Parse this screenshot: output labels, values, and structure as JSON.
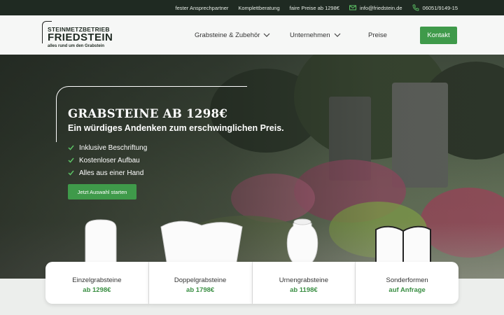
{
  "topbar": {
    "items": [
      "fester Ansprechpartner",
      "Komplettberatung",
      "faire Preise ab 1298€"
    ],
    "email": "info@friedstein.de",
    "phone": "06051/9149-15"
  },
  "logo": {
    "line1": "STEINMETZBETRIEB",
    "line2": "FRIEDSTEIN",
    "line3": "alles rund um den Grabstein"
  },
  "nav": {
    "items": [
      {
        "label": "Grabsteine & Zubehör",
        "dropdown": true
      },
      {
        "label": "Unternehmen",
        "dropdown": true
      },
      {
        "label": "Preise",
        "dropdown": false
      }
    ],
    "contact_button": "Kontakt"
  },
  "hero": {
    "title": "GRABSTEINE AB 1298€",
    "subtitle": "Ein würdiges Andenken zum erschwinglichen Preis.",
    "features": [
      "Inklusive Beschriftung",
      "Kostenloser Aufbau",
      "Alles aus einer Hand"
    ],
    "cta": "Jetzt Auswahl starten"
  },
  "categories": [
    {
      "name": "Einzelgrabsteine",
      "price": "ab 1298€",
      "icon": "single-stone-icon"
    },
    {
      "name": "Doppelgrabsteine",
      "price": "ab 1798€",
      "icon": "double-stone-icon"
    },
    {
      "name": "Urnengrabsteine",
      "price": "ab 1198€",
      "icon": "urn-stone-icon"
    },
    {
      "name": "Sonderformen",
      "price": "auf Anfrage",
      "icon": "book-stone-icon"
    }
  ],
  "colors": {
    "accent": "#3f9a4a",
    "topbar": "#1f2a22",
    "price": "#3b8f44"
  }
}
